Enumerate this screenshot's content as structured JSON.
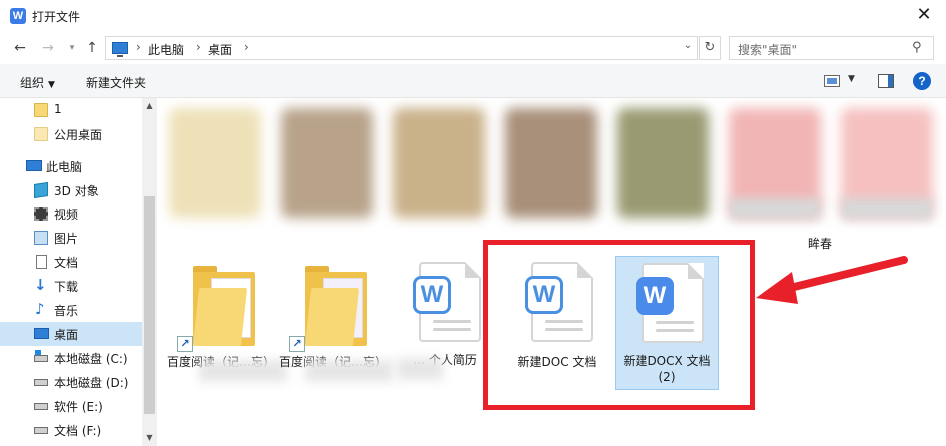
{
  "window": {
    "title": "打开文件",
    "app_icon": "W",
    "close_glyph": "✕"
  },
  "address": {
    "crumbs": [
      "此电脑",
      "桌面"
    ],
    "search_placeholder": "搜索\"桌面\""
  },
  "toolbar": {
    "organize_label": "组织",
    "new_folder_label": "新建文件夹"
  },
  "nav": {
    "items": [
      {
        "label": "1",
        "icon": "folder-icon"
      },
      {
        "label": "公用桌面",
        "icon": "folder-icon"
      },
      {
        "label": "此电脑",
        "icon": "computer-icon"
      },
      {
        "label": "3D 对象",
        "icon": "cube-icon"
      },
      {
        "label": "视频",
        "icon": "video-icon"
      },
      {
        "label": "图片",
        "icon": "picture-icon"
      },
      {
        "label": "文档",
        "icon": "document-icon"
      },
      {
        "label": "下载",
        "icon": "download-icon"
      },
      {
        "label": "音乐",
        "icon": "music-icon"
      },
      {
        "label": "桌面",
        "icon": "desktop-icon",
        "selected": true
      },
      {
        "label": "本地磁盘 (C:)",
        "icon": "drive-icon"
      },
      {
        "label": "本地磁盘 (D:)",
        "icon": "drive-icon"
      },
      {
        "label": "软件 (E:)",
        "icon": "drive-icon"
      },
      {
        "label": "文档 (F:)",
        "icon": "drive-icon"
      }
    ]
  },
  "files": {
    "top_row_visible_label": "眸春",
    "partial_label_left": "… 杂 ……",
    "folder1_label": "百度阅读（记…忘）",
    "folder2_label": "百度阅读（记…忘）",
    "doc1_label": "… 个人简历",
    "doc2_label": "新建DOC 文档",
    "doc3_label_line1": "新建DOCX 文档",
    "doc3_label_line2": "(2)"
  },
  "annotation": {
    "color": "#e8202a"
  }
}
